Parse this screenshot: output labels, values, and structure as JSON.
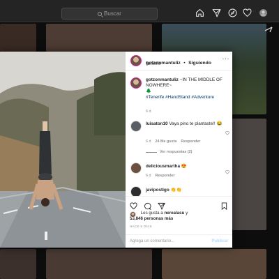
{
  "header": {
    "search_placeholder": "Buscar",
    "nav_icons": [
      "home-icon",
      "direct-message-icon",
      "explore-icon",
      "activity-heart-icon",
      "profile-avatar-icon"
    ]
  },
  "post": {
    "username": "gotzonmantuliz",
    "follow_separator": "•",
    "follow_label": "Siguiendo",
    "location": "Tenerife",
    "more_label": "···",
    "caption": {
      "username": "gotzonmantuliz",
      "text": "~IN THE MIDDLE OF NOWHERE~",
      "tree_emoji": "🌲",
      "hashtags": "#Tenerife #HandStand #Adventure",
      "age": "6 d"
    },
    "comments": [
      {
        "username": "luisaton10",
        "text": "Vaya pino te plantaste!!",
        "emoji": "😂",
        "age": "6 d",
        "likes": "24 Me gusta",
        "reply": "Responder",
        "view_replies": "Ver respuestas (2)"
      },
      {
        "username": "deliciousmartha",
        "emoji": "😍",
        "age": "6 d",
        "reply": "Responder"
      },
      {
        "username": "javipostigo",
        "emoji": "👏👏"
      }
    ],
    "likes_prefix": "Les gusta a",
    "likes_user": "nerealasu",
    "likes_and": "y",
    "likes_count": "53,846 personas más",
    "time_ago": "HACE 6 DÍAS",
    "add_comment_placeholder": "Agrega un comentario...",
    "publish_label": "Publicar"
  },
  "colors": {
    "accent": "#0095f6",
    "hashtag": "#00376b",
    "meta_grey": "#8e8e8e",
    "text": "#262626"
  }
}
